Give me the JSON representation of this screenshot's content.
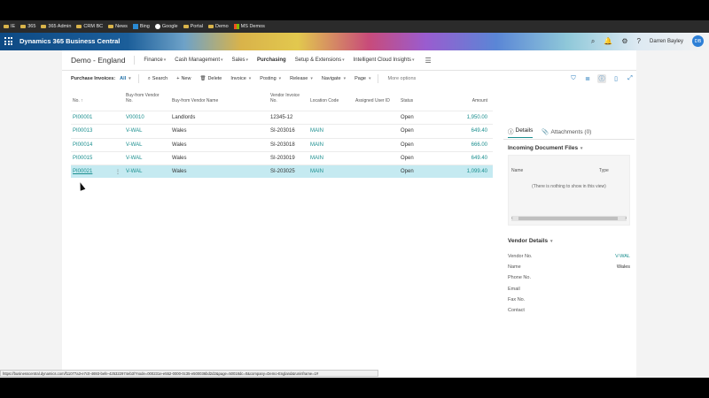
{
  "bookmarks": [
    "IE",
    "365",
    "365 Admin",
    "CRM BC",
    "News",
    "Bing",
    "Google",
    "Portal",
    "Demo",
    "MS Demos"
  ],
  "app": {
    "title": "Dynamics 365 Business Central",
    "user_name": "Darren Bayley",
    "user_initials": "DB"
  },
  "nav": {
    "company": "Demo - England",
    "items": [
      "Finance",
      "Cash Management",
      "Sales",
      "Purchasing",
      "Setup & Extensions",
      "Intelligent Cloud Insights"
    ],
    "active": "Purchasing"
  },
  "actions": {
    "page_label": "Purchase Invoices:",
    "filter_value": "All",
    "search": "Search",
    "new": "New",
    "delete": "Delete",
    "invoice": "Invoice",
    "posting": "Posting",
    "release": "Release",
    "navigate": "Navigate",
    "page": "Page",
    "more": "More options"
  },
  "table": {
    "headers": {
      "no": "No. ↑",
      "vendor_no": "Buy-from Vendor\nNo.",
      "vendor_name": "Buy-from Vendor Name",
      "vendor_invoice": "Vendor Invoice\nNo.",
      "location": "Location Code",
      "assigned_user": "Assigned User ID",
      "status": "Status",
      "amount": "Amount"
    },
    "rows": [
      {
        "no": "PI00001",
        "vendor_no": "V00010",
        "vendor_name": "Landlords",
        "vendor_invoice": "12345-12",
        "location": "",
        "assigned_user": "",
        "status": "Open",
        "amount": "1,950.00"
      },
      {
        "no": "PI00013",
        "vendor_no": "V-WAL",
        "vendor_name": "Wales",
        "vendor_invoice": "SI-203016",
        "location": "MAIN",
        "assigned_user": "",
        "status": "Open",
        "amount": "649.40"
      },
      {
        "no": "PI00014",
        "vendor_no": "V-WAL",
        "vendor_name": "Wales",
        "vendor_invoice": "SI-203018",
        "location": "MAIN",
        "assigned_user": "",
        "status": "Open",
        "amount": "666.00"
      },
      {
        "no": "PI00015",
        "vendor_no": "V-WAL",
        "vendor_name": "Wales",
        "vendor_invoice": "SI-203019",
        "location": "MAIN",
        "assigned_user": "",
        "status": "Open",
        "amount": "649.40"
      },
      {
        "no": "PI00021",
        "vendor_no": "V-WAL",
        "vendor_name": "Wales",
        "vendor_invoice": "SI-203025",
        "location": "MAIN",
        "assigned_user": "",
        "status": "Open",
        "amount": "1,099.40",
        "selected": true
      }
    ]
  },
  "factbox": {
    "tab_details": "Details",
    "tab_attachments": "Attachments (0)",
    "incoming_title": "Incoming Document Files",
    "col_name": "Name",
    "col_type": "Type",
    "empty_text": "(There is nothing to show in this view)",
    "vendor_details_title": "Vendor Details",
    "fields": [
      {
        "label": "Vendor No.",
        "value": "V-WAL",
        "link": true
      },
      {
        "label": "Name",
        "value": "Wales",
        "link": false
      },
      {
        "label": "Phone No.",
        "value": "",
        "link": false
      },
      {
        "label": "Email",
        "value": "",
        "link": false
      },
      {
        "label": "Fax No.",
        "value": "",
        "link": false
      },
      {
        "label": "Contact",
        "value": "",
        "link": false
      }
    ]
  },
  "status_url": "https://businesscentral.dynamics.com/f11077a3-e7c0-4693-befe-425322974eb3/?node=000231e-e552-0000-0c35-e500036bd2d2&page=50018dc=0&company=Demo-England&runinframe=1#",
  "colors": {
    "link": "#1b8f8f",
    "selected_row": "#c5eaf1",
    "brand": "#0e4a84"
  }
}
